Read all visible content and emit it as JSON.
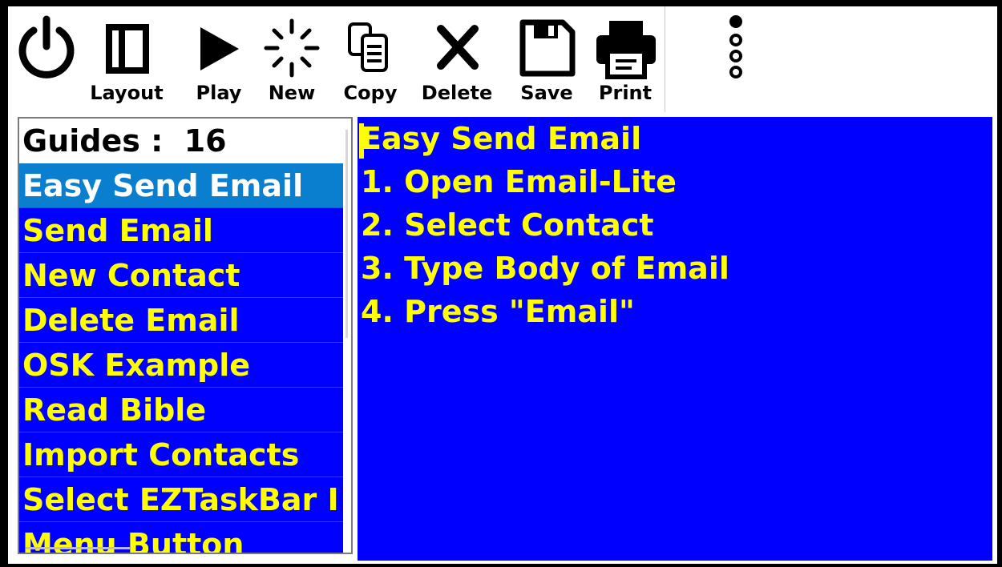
{
  "toolbar": {
    "power": {
      "icon": "power-icon"
    },
    "layout": {
      "label": "Layout",
      "icon": "layout-icon"
    },
    "play": {
      "label": "Play",
      "icon": "play-icon"
    },
    "new": {
      "label": "New",
      "icon": "sparkle-icon"
    },
    "copy": {
      "label": "Copy",
      "icon": "copy-icon"
    },
    "delete": {
      "label": "Delete",
      "icon": "close-icon"
    },
    "save": {
      "label": "Save",
      "icon": "floppy-disk-icon"
    },
    "print": {
      "label": "Print",
      "icon": "printer-icon"
    },
    "more": {
      "icon": "more-vertical-icon"
    }
  },
  "guides": {
    "header": "Guides :  16",
    "items": [
      "Easy Send Email",
      "Send Email",
      "New Contact",
      "Delete Email",
      "OSK Example",
      "Read Bible",
      "Import Contacts",
      "Select EZTaskBar I",
      "Menu Button"
    ],
    "selected_index": 0
  },
  "content": {
    "lines": [
      "Easy Send Email",
      "1. Open Email-Lite",
      "2. Select Contact",
      "3. Type Body of Email",
      "4. Press \"Email\""
    ]
  },
  "colors": {
    "list_bg": "#0000ff",
    "list_text": "#ffff00",
    "selected_bg": "#0a7fd0",
    "selected_text": "#ffffff"
  }
}
